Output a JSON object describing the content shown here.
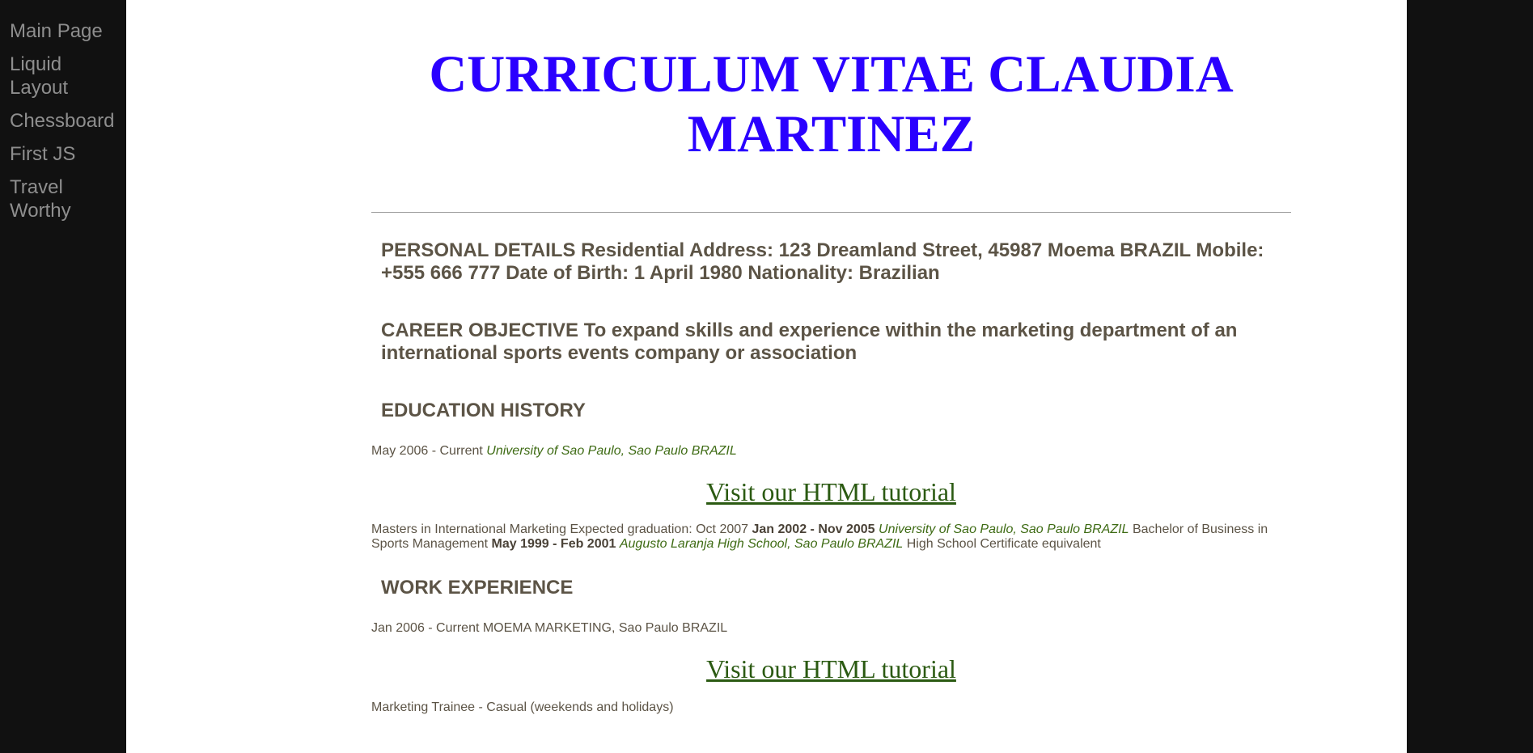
{
  "nav": {
    "items": [
      {
        "label": "Main Page"
      },
      {
        "label": "Liquid Layout"
      },
      {
        "label": "Chessboard"
      },
      {
        "label": "First JS"
      },
      {
        "label": "Travel Worthy"
      }
    ]
  },
  "cv": {
    "title": "CURRICULUM VITAE CLAUDIA MARTINEZ",
    "personal": "PERSONAL DETAILS Residential Address: 123 Dreamland Street, 45987 Moema BRAZIL Mobile: +555 666 777 Date of Birth: 1 April 1980 Nationality: Brazilian",
    "objective": "CAREER OBJECTIVE To expand skills and experience within the marketing department of an international sports events company or association",
    "education_heading": "EDUCATION HISTORY",
    "education_line1": {
      "date": "May 2006 - Current ",
      "place": "University of Sao Paulo, Sao Paulo BRAZIL"
    },
    "tutorial_link": "Visit our HTML tutorial",
    "education_details": {
      "t1": "Masters in International Marketing Expected graduation: Oct 2007 ",
      "d1": "Jan 2002 - Nov 2005",
      "p1": "University of Sao Paulo, Sao Paulo BRAZIL",
      "t2": " Bachelor of Business in Sports Management ",
      "d2": "May 1999 - Feb 2001",
      "p2": "Augusto Laranja High School, Sao Paulo BRAZIL",
      "t3": " High School Certificate equivalent"
    },
    "work_heading": "WORK EXPERIENCE",
    "work_line1": "Jan 2006 - Current MOEMA MARKETING, Sao Paulo BRAZIL",
    "work_line2": "Marketing Trainee - Casual (weekends and holidays)"
  }
}
